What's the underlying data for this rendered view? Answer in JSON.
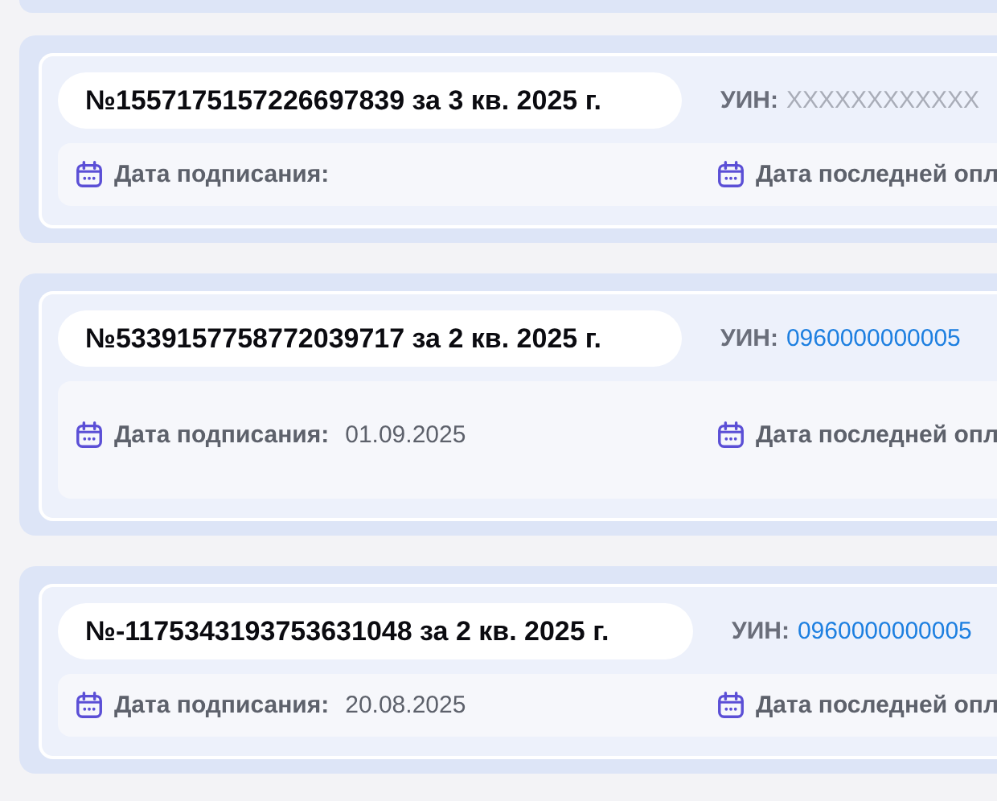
{
  "cards": [
    {
      "title": "№1557175157226697839 за 3 кв. 2025 г.",
      "uin": {
        "label": "УИН:",
        "value": "XXXXXXXXXXXX",
        "kind": "masked"
      },
      "fields": [
        {
          "label": "Дата подписания:"
        },
        {
          "label": "Дата последней опл"
        }
      ]
    },
    {
      "title": "№5339157758772039717 за 2 кв. 2025 г.",
      "uin": {
        "label": "УИН:",
        "value": "0960000000005",
        "kind": "link"
      },
      "fields": [
        {
          "label": "Дата подписания:",
          "value": "01.09.2025"
        },
        {
          "label": "Дата последней опл"
        }
      ]
    },
    {
      "title": "№-1175343193753631048 за 2 кв. 2025 г.",
      "uin": {
        "label": "УИН:",
        "value": "0960000000005",
        "kind": "link"
      },
      "fields": [
        {
          "label": "Дата подписания:",
          "value": "20.08.2025"
        },
        {
          "label": "Дата последней опл"
        }
      ]
    }
  ]
}
